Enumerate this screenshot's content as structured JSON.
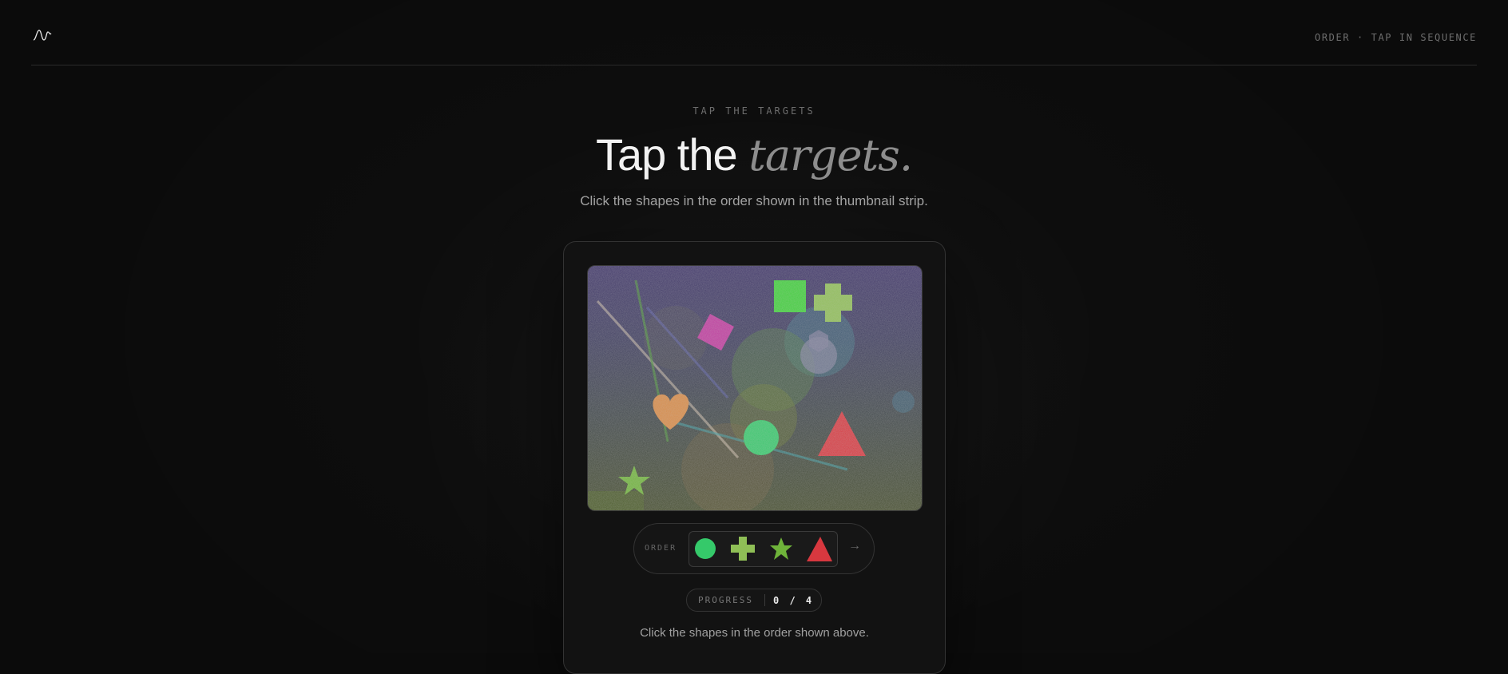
{
  "header": {
    "logo_icon": "waveform-logo-icon",
    "tag": "ORDER · TAP IN SEQUENCE"
  },
  "hero": {
    "eyebrow": "TAP THE TARGETS",
    "title_plain": "Tap the ",
    "title_accent": "targets.",
    "subtitle": "Click the shapes in the order shown in the thumbnail strip."
  },
  "canvas": {
    "shapes": [
      {
        "name": "square-shape",
        "color": "#3fd13a"
      },
      {
        "name": "cross-shape",
        "color": "#8fbf56"
      },
      {
        "name": "diamond-shape",
        "color": "#c0389e"
      },
      {
        "name": "hexagon-shape",
        "color": "#6d7290"
      },
      {
        "name": "heart-shape",
        "color": "#d98a45"
      },
      {
        "name": "circle-shape",
        "color": "#35c96a"
      },
      {
        "name": "triangle-shape",
        "color": "#d8383f"
      },
      {
        "name": "star-shape",
        "color": "#6fb43a"
      }
    ]
  },
  "order": {
    "label": "ORDER",
    "sequence": [
      {
        "name": "circle-shape",
        "color": "#35c96a"
      },
      {
        "name": "cross-shape",
        "color": "#8fbf56"
      },
      {
        "name": "star-shape",
        "color": "#6fb43a"
      },
      {
        "name": "triangle-shape",
        "color": "#d8383f"
      }
    ],
    "next_icon": "→"
  },
  "progress": {
    "label": "PROGRESS",
    "value": "0 / 4",
    "current": 0,
    "total": 4
  },
  "instruction": "Click the shapes in the order shown above."
}
